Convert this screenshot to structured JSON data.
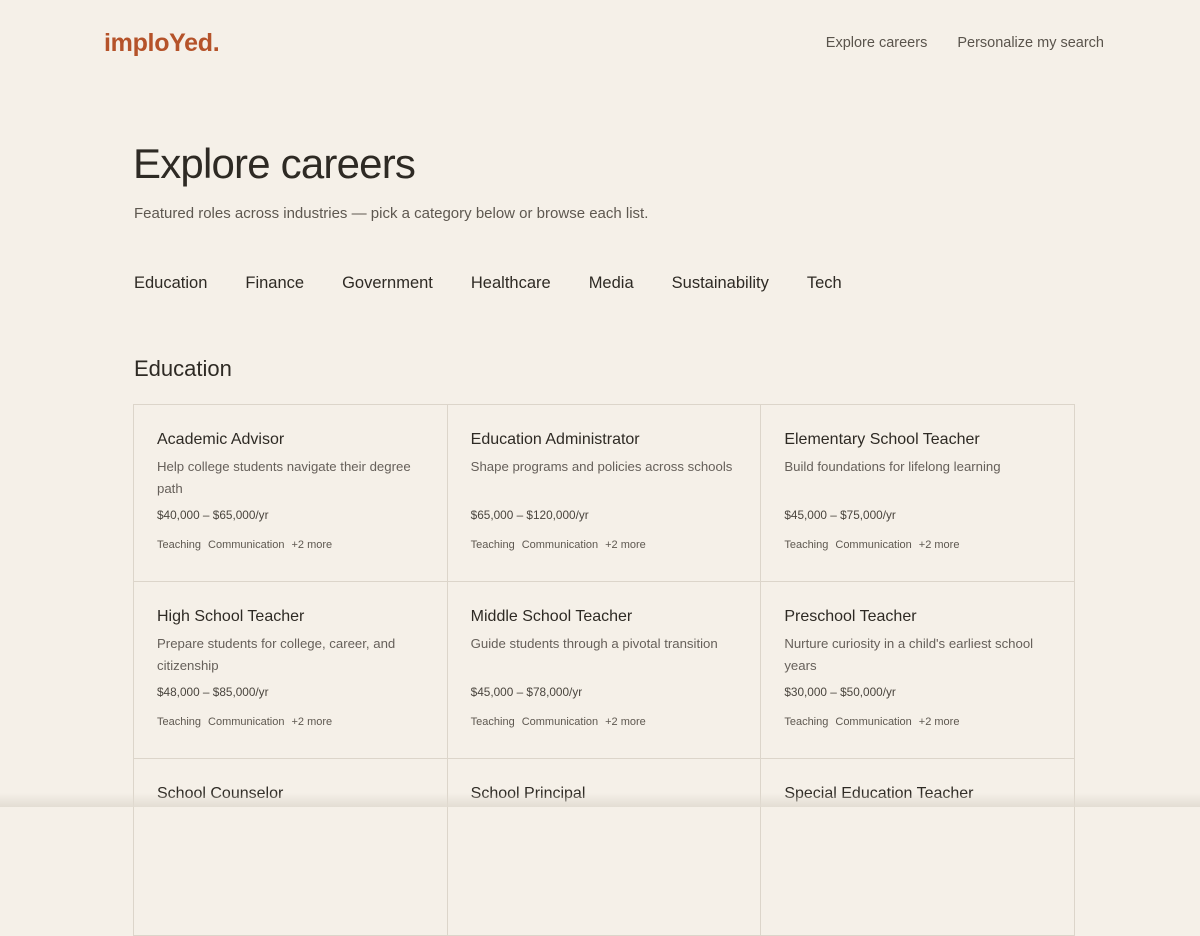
{
  "colors": {
    "background": "#f5f0e8",
    "brand": "#b5532a",
    "text": "#2e2a24",
    "muted_text": "#5e5850",
    "border": "#dcd5ca"
  },
  "header": {
    "logo_prefix": "implo",
    "logo_y": "Y",
    "logo_suffix": "ed.",
    "nav": [
      {
        "label": "Explore careers"
      },
      {
        "label": "Personalize my search"
      }
    ]
  },
  "intro": {
    "title": "Explore careers",
    "subtitle": "Featured roles across industries — pick a category below or browse each list."
  },
  "categories": [
    {
      "label": "Education"
    },
    {
      "label": "Finance"
    },
    {
      "label": "Government"
    },
    {
      "label": "Healthcare"
    },
    {
      "label": "Media"
    },
    {
      "label": "Sustainability"
    },
    {
      "label": "Tech"
    }
  ],
  "section": {
    "title": "Education",
    "cards": [
      {
        "title": "Academic Advisor",
        "desc": "Help college students navigate their degree path",
        "salary": "$40,000 – $65,000/yr",
        "tags": [
          "Teaching",
          "Communication",
          "+2 more"
        ]
      },
      {
        "title": "Education Administrator",
        "desc": "Shape programs and policies across schools",
        "salary": "$65,000 – $120,000/yr",
        "tags": [
          "Teaching",
          "Communication",
          "+2 more"
        ]
      },
      {
        "title": "Elementary School Teacher",
        "desc": "Build foundations for lifelong learning",
        "salary": "$45,000 – $75,000/yr",
        "tags": [
          "Teaching",
          "Communication",
          "+2 more"
        ]
      },
      {
        "title": "High School Teacher",
        "desc": "Prepare students for college, career, and citizenship",
        "salary": "$48,000 – $85,000/yr",
        "tags": [
          "Teaching",
          "Communication",
          "+2 more"
        ]
      },
      {
        "title": "Middle School Teacher",
        "desc": "Guide students through a pivotal transition",
        "salary": "$45,000 – $78,000/yr",
        "tags": [
          "Teaching",
          "Communication",
          "+2 more"
        ]
      },
      {
        "title": "Preschool Teacher",
        "desc": "Nurture curiosity in a child's earliest school years",
        "salary": "$30,000 – $50,000/yr",
        "tags": [
          "Teaching",
          "Communication",
          "+2 more"
        ]
      },
      {
        "title": "School Counselor",
        "desc": "",
        "salary": "",
        "tags": []
      },
      {
        "title": "School Principal",
        "desc": "",
        "salary": "",
        "tags": []
      },
      {
        "title": "Special Education Teacher",
        "desc": "",
        "salary": "",
        "tags": []
      }
    ]
  }
}
